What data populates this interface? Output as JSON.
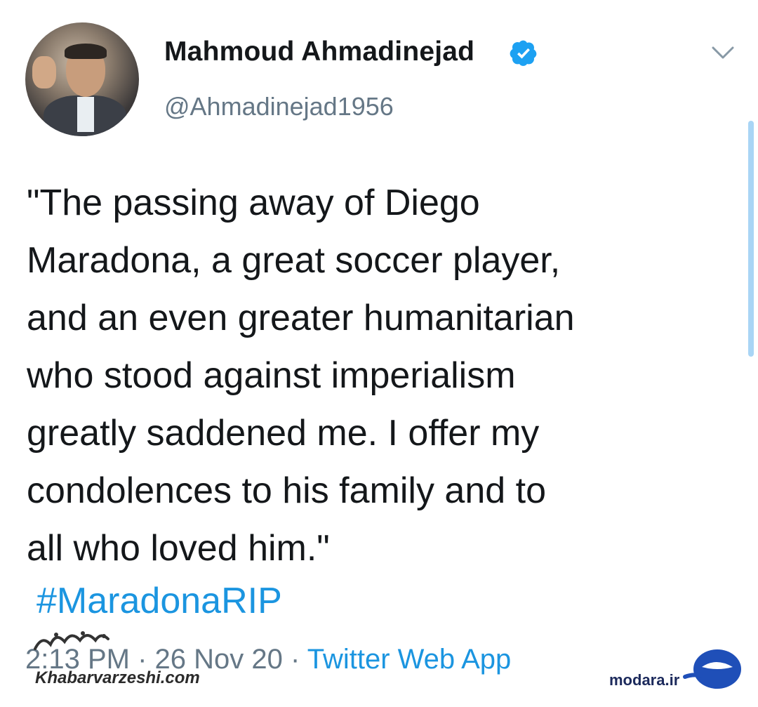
{
  "author": {
    "name": "Mahmoud Ahmadinejad",
    "handle": "@Ahmadinejad1956",
    "verified_icon": "verified-badge-icon",
    "avatar": "profile-photo"
  },
  "tweet": {
    "text": "\"The passing away of Diego\nMaradona, a great soccer player,\nand an even greater humanitarian\nwho stood against imperialism\ngreatly saddened me. I offer my\ncondolences to his family and to\nall who loved him.\"",
    "hashtag": "#MaradonaRIP",
    "time": "2:13 PM",
    "separator": "·",
    "date": "26 Nov 20",
    "source": "Twitter Web App"
  },
  "watermarks": {
    "left": "Khabarvarzeshi.com",
    "right": "modara.ir"
  },
  "colors": {
    "link": "#1b95e0",
    "secondary_text": "#657786",
    "primary_text": "#14171a",
    "verified": "#1da1f2"
  }
}
